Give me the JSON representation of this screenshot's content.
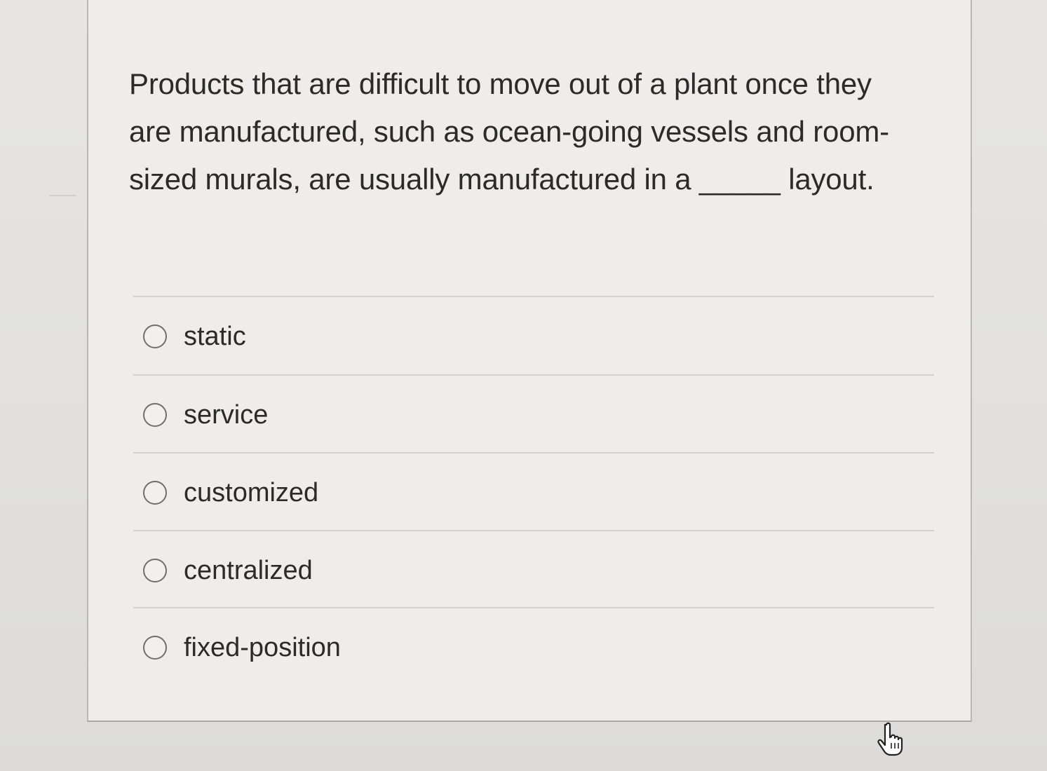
{
  "question": {
    "text": "Products that are difficult to move out of a plant once they are manufactured, such as ocean-going vessels and room-sized murals, are usually manufactured in a _____ layout."
  },
  "options": [
    {
      "label": "static",
      "selected": false
    },
    {
      "label": "service",
      "selected": false
    },
    {
      "label": "customized",
      "selected": false
    },
    {
      "label": "centralized",
      "selected": false
    },
    {
      "label": "fixed-position",
      "selected": false
    }
  ],
  "icons": {
    "cursor": "hand-pointer-icon",
    "option": "radio-button-icon"
  }
}
